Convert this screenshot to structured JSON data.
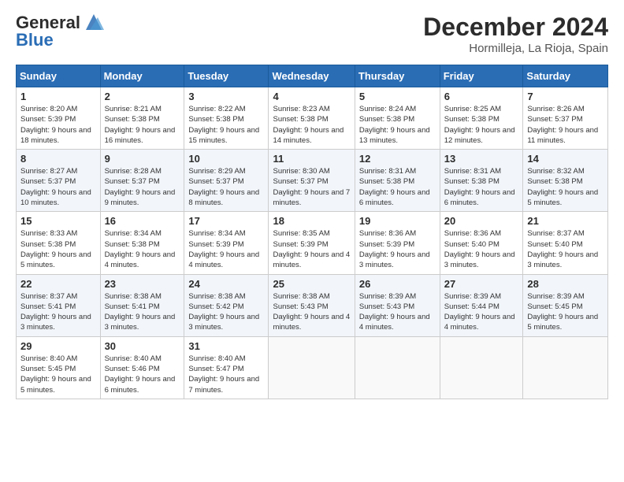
{
  "header": {
    "logo_line1": "General",
    "logo_line2": "Blue",
    "month": "December 2024",
    "location": "Hormilleja, La Rioja, Spain"
  },
  "weekdays": [
    "Sunday",
    "Monday",
    "Tuesday",
    "Wednesday",
    "Thursday",
    "Friday",
    "Saturday"
  ],
  "weeks": [
    [
      {
        "day": "1",
        "info": "Sunrise: 8:20 AM\nSunset: 5:39 PM\nDaylight: 9 hours and 18 minutes."
      },
      {
        "day": "2",
        "info": "Sunrise: 8:21 AM\nSunset: 5:38 PM\nDaylight: 9 hours and 16 minutes."
      },
      {
        "day": "3",
        "info": "Sunrise: 8:22 AM\nSunset: 5:38 PM\nDaylight: 9 hours and 15 minutes."
      },
      {
        "day": "4",
        "info": "Sunrise: 8:23 AM\nSunset: 5:38 PM\nDaylight: 9 hours and 14 minutes."
      },
      {
        "day": "5",
        "info": "Sunrise: 8:24 AM\nSunset: 5:38 PM\nDaylight: 9 hours and 13 minutes."
      },
      {
        "day": "6",
        "info": "Sunrise: 8:25 AM\nSunset: 5:38 PM\nDaylight: 9 hours and 12 minutes."
      },
      {
        "day": "7",
        "info": "Sunrise: 8:26 AM\nSunset: 5:37 PM\nDaylight: 9 hours and 11 minutes."
      }
    ],
    [
      {
        "day": "8",
        "info": "Sunrise: 8:27 AM\nSunset: 5:37 PM\nDaylight: 9 hours and 10 minutes."
      },
      {
        "day": "9",
        "info": "Sunrise: 8:28 AM\nSunset: 5:37 PM\nDaylight: 9 hours and 9 minutes."
      },
      {
        "day": "10",
        "info": "Sunrise: 8:29 AM\nSunset: 5:37 PM\nDaylight: 9 hours and 8 minutes."
      },
      {
        "day": "11",
        "info": "Sunrise: 8:30 AM\nSunset: 5:37 PM\nDaylight: 9 hours and 7 minutes."
      },
      {
        "day": "12",
        "info": "Sunrise: 8:31 AM\nSunset: 5:38 PM\nDaylight: 9 hours and 6 minutes."
      },
      {
        "day": "13",
        "info": "Sunrise: 8:31 AM\nSunset: 5:38 PM\nDaylight: 9 hours and 6 minutes."
      },
      {
        "day": "14",
        "info": "Sunrise: 8:32 AM\nSunset: 5:38 PM\nDaylight: 9 hours and 5 minutes."
      }
    ],
    [
      {
        "day": "15",
        "info": "Sunrise: 8:33 AM\nSunset: 5:38 PM\nDaylight: 9 hours and 5 minutes."
      },
      {
        "day": "16",
        "info": "Sunrise: 8:34 AM\nSunset: 5:38 PM\nDaylight: 9 hours and 4 minutes."
      },
      {
        "day": "17",
        "info": "Sunrise: 8:34 AM\nSunset: 5:39 PM\nDaylight: 9 hours and 4 minutes."
      },
      {
        "day": "18",
        "info": "Sunrise: 8:35 AM\nSunset: 5:39 PM\nDaylight: 9 hours and 4 minutes."
      },
      {
        "day": "19",
        "info": "Sunrise: 8:36 AM\nSunset: 5:39 PM\nDaylight: 9 hours and 3 minutes."
      },
      {
        "day": "20",
        "info": "Sunrise: 8:36 AM\nSunset: 5:40 PM\nDaylight: 9 hours and 3 minutes."
      },
      {
        "day": "21",
        "info": "Sunrise: 8:37 AM\nSunset: 5:40 PM\nDaylight: 9 hours and 3 minutes."
      }
    ],
    [
      {
        "day": "22",
        "info": "Sunrise: 8:37 AM\nSunset: 5:41 PM\nDaylight: 9 hours and 3 minutes."
      },
      {
        "day": "23",
        "info": "Sunrise: 8:38 AM\nSunset: 5:41 PM\nDaylight: 9 hours and 3 minutes."
      },
      {
        "day": "24",
        "info": "Sunrise: 8:38 AM\nSunset: 5:42 PM\nDaylight: 9 hours and 3 minutes."
      },
      {
        "day": "25",
        "info": "Sunrise: 8:38 AM\nSunset: 5:43 PM\nDaylight: 9 hours and 4 minutes."
      },
      {
        "day": "26",
        "info": "Sunrise: 8:39 AM\nSunset: 5:43 PM\nDaylight: 9 hours and 4 minutes."
      },
      {
        "day": "27",
        "info": "Sunrise: 8:39 AM\nSunset: 5:44 PM\nDaylight: 9 hours and 4 minutes."
      },
      {
        "day": "28",
        "info": "Sunrise: 8:39 AM\nSunset: 5:45 PM\nDaylight: 9 hours and 5 minutes."
      }
    ],
    [
      {
        "day": "29",
        "info": "Sunrise: 8:40 AM\nSunset: 5:45 PM\nDaylight: 9 hours and 5 minutes."
      },
      {
        "day": "30",
        "info": "Sunrise: 8:40 AM\nSunset: 5:46 PM\nDaylight: 9 hours and 6 minutes."
      },
      {
        "day": "31",
        "info": "Sunrise: 8:40 AM\nSunset: 5:47 PM\nDaylight: 9 hours and 7 minutes."
      },
      null,
      null,
      null,
      null
    ]
  ]
}
